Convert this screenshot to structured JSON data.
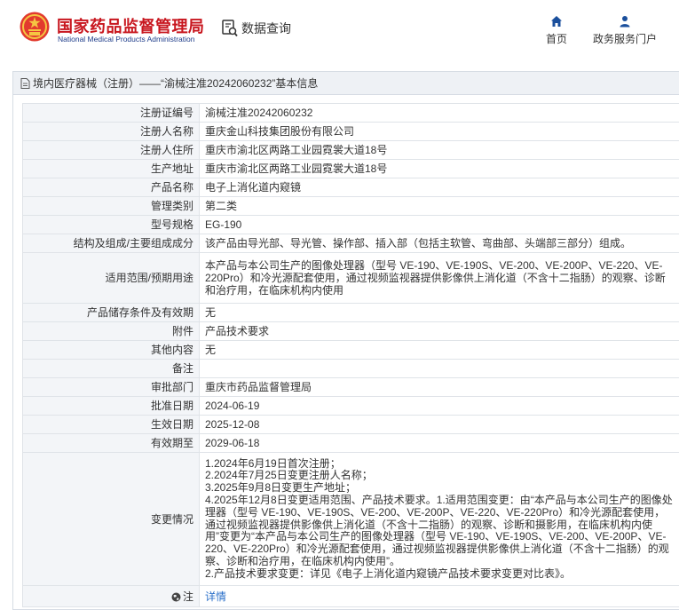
{
  "header": {
    "org_name_cn": "国家药品监督管理局",
    "org_name_en": "National Medical Products Administration",
    "data_query_label": "数据查询",
    "nav": {
      "home_label": "首页",
      "service_label": "政务服务门户"
    }
  },
  "panel": {
    "title": "境内医疗器械（注册）——“渝械注准20242060232”基本信息"
  },
  "rows": [
    {
      "label": "注册证编号",
      "value": "渝械注准20242060232"
    },
    {
      "label": "注册人名称",
      "value": "重庆金山科技集团股份有限公司"
    },
    {
      "label": "注册人住所",
      "value": "重庆市渝北区两路工业园霓裳大道18号"
    },
    {
      "label": "生产地址",
      "value": "重庆市渝北区两路工业园霓裳大道18号"
    },
    {
      "label": "产品名称",
      "value": "电子上消化道内窥镜"
    },
    {
      "label": "管理类别",
      "value": "第二类"
    },
    {
      "label": "型号规格",
      "value": "EG-190"
    },
    {
      "label": "结构及组成/主要组成成分",
      "value": "该产品由导光部、导光管、操作部、插入部（包括主软管、弯曲部、头端部三部分）组成。"
    },
    {
      "label": "适用范围/预期用途",
      "value": "本产品与本公司生产的图像处理器（型号 VE-190、VE-190S、VE-200、VE-200P、VE-220、VE-220Pro）和冷光源配套使用，通过视频监视器提供影像供上消化道（不含十二指肠）的观察、诊断和治疗用，在临床机构内使用"
    },
    {
      "label": "产品储存条件及有效期",
      "value": "无"
    },
    {
      "label": "附件",
      "value": "产品技术要求"
    },
    {
      "label": "其他内容",
      "value": "无"
    },
    {
      "label": "备注",
      "value": ""
    },
    {
      "label": "审批部门",
      "value": "重庆市药品监督管理局"
    },
    {
      "label": "批准日期",
      "value": "2024-06-19"
    },
    {
      "label": "生效日期",
      "value": "2025-12-08"
    },
    {
      "label": "有效期至",
      "value": "2029-06-18"
    }
  ],
  "changes": {
    "label": "变更情况",
    "lines": [
      "1.2024年6月19日首次注册；",
      "2.2024年7月25日变更注册人名称；",
      "3.2025年9月8日变更生产地址；",
      "4.2025年12月8日变更适用范围、产品技术要求。1.适用范围变更：由“本产品与本公司生产的图像处理器（型号 VE-190、VE-190S、VE-200、VE-200P、VE-220、VE-220Pro）和冷光源配套使用，通过视频监视器提供影像供上消化道（不含十二指肠）的观察、诊断和摄影用，在临床机构内使用”变更为“本产品与本公司生产的图像处理器（型号 VE-190、VE-190S、VE-200、VE-200P、VE-220、VE-220Pro）和冷光源配套使用，通过视频监视器提供影像供上消化道（不含十二指肠）的观察、诊断和治疗用，在临床机构内使用”。",
      "2.产品技术要求变更：详见《电子上消化道内窥镜产品技术要求变更对比表》。"
    ]
  },
  "remark_row": {
    "label": "注",
    "link_text": "详情"
  },
  "colors": {
    "brand_red": "#c8161e",
    "brand_blue": "#1f3d8a",
    "nav_blue": "#1a4f9c",
    "link_blue": "#2a6fc9"
  }
}
